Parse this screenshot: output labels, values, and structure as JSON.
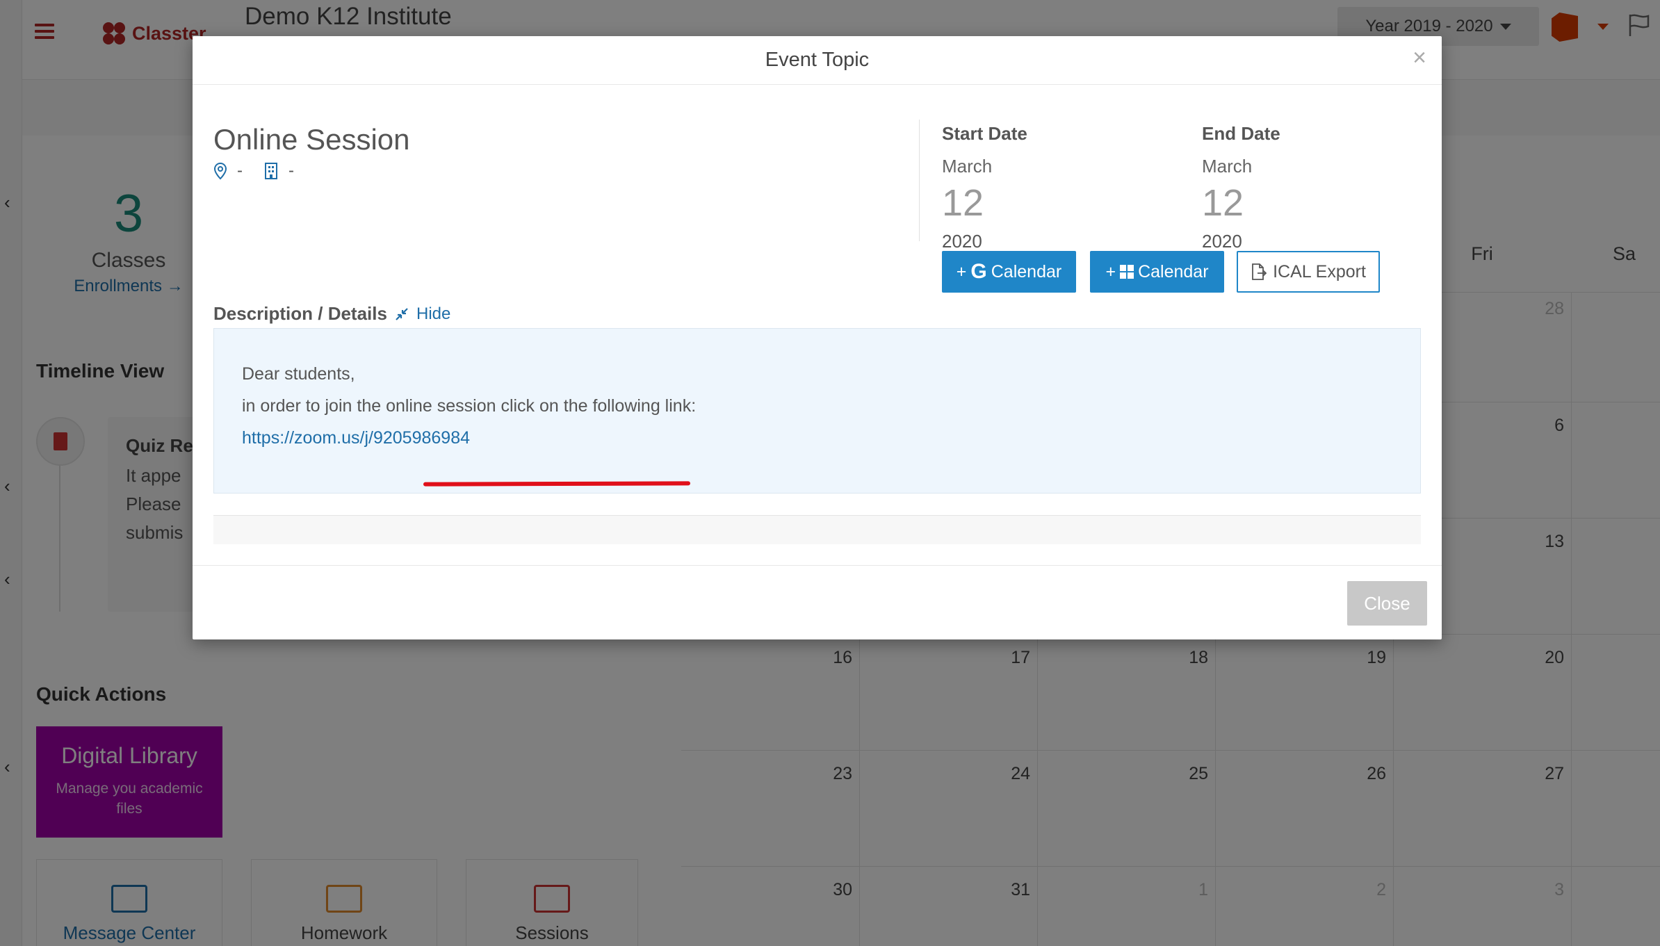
{
  "header": {
    "logo_text": "Classter",
    "institute": "Demo K12 Institute",
    "year_select": "Year 2019 - 2020"
  },
  "stats": {
    "number": "3",
    "label": "Classes",
    "link": "Enrollments"
  },
  "timeline": {
    "title": "Timeline View",
    "card_title": "Quiz Re",
    "card_lines": [
      "It appe",
      "Please",
      "submis"
    ]
  },
  "quick_actions": {
    "title": "Quick Actions",
    "digital_library": {
      "title": "Digital Library",
      "subtitle": "Manage you academic files"
    },
    "tiles": [
      "Message Center",
      "Homework",
      "Sessions"
    ]
  },
  "calendar": {
    "headers": [
      "Fri",
      "Sa"
    ],
    "rows": [
      [
        "",
        "",
        "",
        "",
        "28"
      ],
      [
        "",
        "",
        "",
        "",
        "6"
      ],
      [
        "",
        "",
        "",
        "",
        "13"
      ],
      [
        "16",
        "17",
        "18",
        "19",
        "20"
      ],
      [
        "23",
        "24",
        "25",
        "26",
        "27"
      ],
      [
        "30",
        "31",
        "1",
        "2",
        "3"
      ]
    ]
  },
  "modal": {
    "title": "Event Topic",
    "event_title": "Online Session",
    "location": "-",
    "building": "-",
    "start": {
      "label": "Start Date",
      "month": "March",
      "day": "12",
      "year": "2020"
    },
    "end": {
      "label": "End Date",
      "month": "March",
      "day": "12",
      "year": "2020"
    },
    "google_cal": "Calendar",
    "windows_cal": "Calendar",
    "ical": "ICAL Export",
    "desc_label": "Description / Details",
    "hide": "Hide",
    "desc_lines": [
      "Dear students,",
      "in order to join the online session click on the following link:"
    ],
    "link": "https://zoom.us/j/9205986984",
    "close": "Close"
  }
}
